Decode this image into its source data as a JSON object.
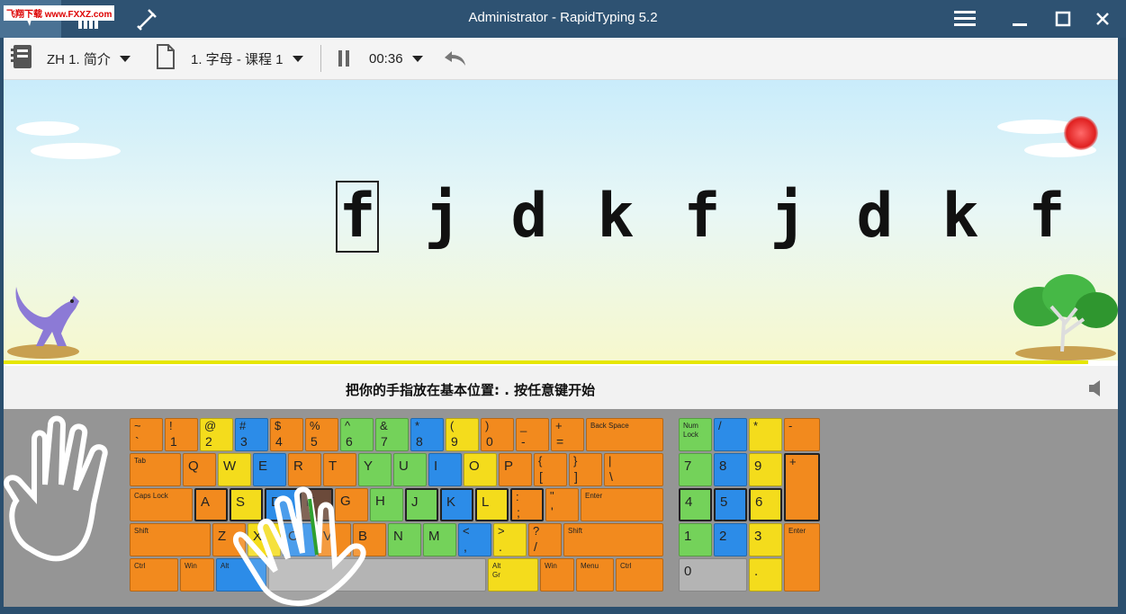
{
  "watermark": "飞翔下载 www.FXXZ.com",
  "title": "Administrator - RapidTyping 5.2",
  "toolbar": {
    "course": "ZH 1. 简介",
    "lesson": "1. 字母 - 课程 1",
    "timer": "00:36"
  },
  "exercise": {
    "letters": [
      "f",
      "j",
      "d",
      "k",
      "f",
      "j",
      "d",
      "k",
      "f"
    ],
    "current_index": 0
  },
  "status": {
    "text": "把你的手指放在基本位置:  . 按任意键开始"
  },
  "keyboard": {
    "row1": [
      {
        "t": "~",
        "b": "`"
      },
      {
        "t": "!",
        "b": "1"
      },
      {
        "t": "@",
        "b": "2"
      },
      {
        "t": "#",
        "b": "3"
      },
      {
        "t": "$",
        "b": "4"
      },
      {
        "t": "%",
        "b": "5"
      },
      {
        "t": "^",
        "b": "6"
      },
      {
        "t": "&",
        "b": "7"
      },
      {
        "t": "*",
        "b": "8"
      },
      {
        "t": "(",
        "b": "9"
      },
      {
        "t": ")",
        "b": "0"
      },
      {
        "t": "_",
        "b": "-"
      },
      {
        "t": "+",
        "b": "="
      },
      {
        "t": "Back Space",
        "b": ""
      }
    ],
    "row2": [
      {
        "t": "Tab",
        "b": ""
      },
      {
        "t": "Q",
        "b": ""
      },
      {
        "t": "W",
        "b": ""
      },
      {
        "t": "E",
        "b": ""
      },
      {
        "t": "R",
        "b": ""
      },
      {
        "t": "T",
        "b": ""
      },
      {
        "t": "Y",
        "b": ""
      },
      {
        "t": "U",
        "b": ""
      },
      {
        "t": "I",
        "b": ""
      },
      {
        "t": "O",
        "b": ""
      },
      {
        "t": "P",
        "b": ""
      },
      {
        "t": "{",
        "b": "["
      },
      {
        "t": "}",
        "b": "]"
      },
      {
        "t": "|",
        "b": "\\"
      }
    ],
    "row3": [
      {
        "t": "Caps Lock",
        "b": ""
      },
      {
        "t": "A",
        "b": ""
      },
      {
        "t": "S",
        "b": ""
      },
      {
        "t": "D",
        "b": ""
      },
      {
        "t": "F",
        "b": ""
      },
      {
        "t": "G",
        "b": ""
      },
      {
        "t": "H",
        "b": ""
      },
      {
        "t": "J",
        "b": ""
      },
      {
        "t": "K",
        "b": ""
      },
      {
        "t": "L",
        "b": ""
      },
      {
        "t": ":",
        "b": ";"
      },
      {
        "t": "\"",
        "b": "'"
      },
      {
        "t": "Enter",
        "b": ""
      }
    ],
    "row4": [
      {
        "t": "Shift",
        "b": ""
      },
      {
        "t": "Z",
        "b": ""
      },
      {
        "t": "X",
        "b": ""
      },
      {
        "t": "C",
        "b": ""
      },
      {
        "t": "V",
        "b": ""
      },
      {
        "t": "B",
        "b": ""
      },
      {
        "t": "N",
        "b": ""
      },
      {
        "t": "M",
        "b": ""
      },
      {
        "t": "<",
        "b": ","
      },
      {
        "t": ">",
        "b": "."
      },
      {
        "t": "?",
        "b": "/"
      },
      {
        "t": "Shift",
        "b": ""
      }
    ],
    "row5": [
      {
        "t": "Ctrl",
        "b": ""
      },
      {
        "t": "Win",
        "b": ""
      },
      {
        "t": "Alt",
        "b": ""
      },
      {
        "t": "",
        "b": ""
      },
      {
        "t": "Alt",
        "b": "Gr"
      },
      {
        "t": "Win",
        "b": ""
      },
      {
        "t": "Menu",
        "b": ""
      },
      {
        "t": "Ctrl",
        "b": ""
      }
    ],
    "numpad": [
      {
        "t": "Num",
        "b": "Lock"
      },
      {
        "t": "/",
        "b": ""
      },
      {
        "t": "*",
        "b": ""
      },
      {
        "t": "-",
        "b": ""
      },
      {
        "t": "7",
        "b": ""
      },
      {
        "t": "8",
        "b": ""
      },
      {
        "t": "9",
        "b": ""
      },
      {
        "t": "+",
        "b": ""
      },
      {
        "t": "4",
        "b": ""
      },
      {
        "t": "5",
        "b": ""
      },
      {
        "t": "6",
        "b": ""
      },
      {
        "t": "1",
        "b": ""
      },
      {
        "t": "2",
        "b": ""
      },
      {
        "t": "3",
        "b": ""
      },
      {
        "t": "Enter",
        "b": ""
      },
      {
        "t": "0",
        "b": ""
      },
      {
        "t": ".",
        "b": ""
      }
    ]
  }
}
